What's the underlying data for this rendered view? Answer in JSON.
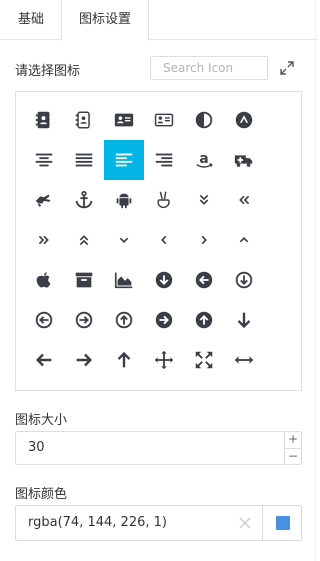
{
  "tabs": [
    {
      "label": "基础",
      "active": false
    },
    {
      "label": "图标设置",
      "active": true
    }
  ],
  "icon_picker": {
    "label": "请选择图标",
    "search_placeholder": "Search Icon",
    "selected_icon": "align-left-icon",
    "icons": [
      "address-book-icon",
      "address-book-outline-icon",
      "address-card-icon",
      "address-card-outline-icon",
      "adjust-icon",
      "adn-icon",
      "align-center-icon",
      "align-justify-icon",
      "align-left-icon",
      "align-right-icon",
      "amazon-icon",
      "ambulance-icon",
      "american-sign-language-icon",
      "anchor-icon",
      "android-icon",
      "angellist-icon",
      "angle-double-down-icon",
      "angle-double-left-icon",
      "angle-double-right-icon",
      "angle-double-up-icon",
      "angle-down-icon",
      "angle-left-icon",
      "angle-right-icon",
      "angle-up-icon",
      "apple-icon",
      "archive-icon",
      "area-chart-icon",
      "arrow-circle-down-icon",
      "arrow-circle-left-icon",
      "arrow-circle-o-down-icon",
      "arrow-circle-o-left-icon",
      "arrow-circle-o-right-icon",
      "arrow-circle-o-up-icon",
      "arrow-circle-right-icon",
      "arrow-circle-up-icon",
      "arrow-down-icon",
      "arrow-left-icon",
      "arrow-right-icon",
      "arrow-up-icon",
      "arrows-icon",
      "arrows-alt-icon",
      "arrows-h-icon"
    ]
  },
  "icon_size": {
    "label": "图标大小",
    "value": "30",
    "plus": "+",
    "minus": "−"
  },
  "icon_color": {
    "label": "图标颜色",
    "value": "rgba(74, 144, 226, 1)",
    "swatch": "#4a90e2"
  },
  "colors": {
    "icon": "#3a3f47",
    "selected_bg": "#00b5e5",
    "selected_fg": "#ffffff"
  }
}
